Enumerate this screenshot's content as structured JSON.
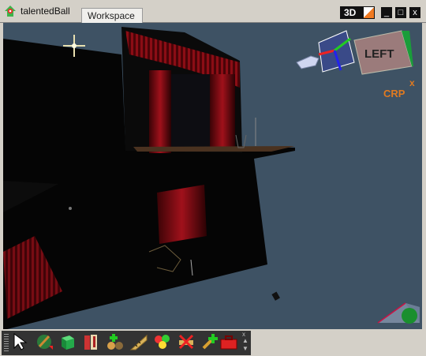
{
  "window": {
    "app_title": "talentedBall",
    "tab_label": "Workspace",
    "mode_label": "3D",
    "controls": {
      "minimize": "_",
      "maximize": "□",
      "close": "x"
    }
  },
  "viewport": {
    "orientation_cube_label": "LEFT",
    "axis_label": "x",
    "crp_label": "CRP",
    "background_color": "#3e5264"
  },
  "toolbar": {
    "tools": [
      {
        "name": "select-arrow-icon"
      },
      {
        "name": "paint-brush-icon"
      },
      {
        "name": "green-box-icon"
      },
      {
        "name": "doors-icon"
      },
      {
        "name": "add-object-icon"
      },
      {
        "name": "ruler-icon"
      },
      {
        "name": "color-balls-icon"
      },
      {
        "name": "remove-icon"
      },
      {
        "name": "add-tool-icon"
      },
      {
        "name": "toolbox-icon"
      }
    ]
  }
}
